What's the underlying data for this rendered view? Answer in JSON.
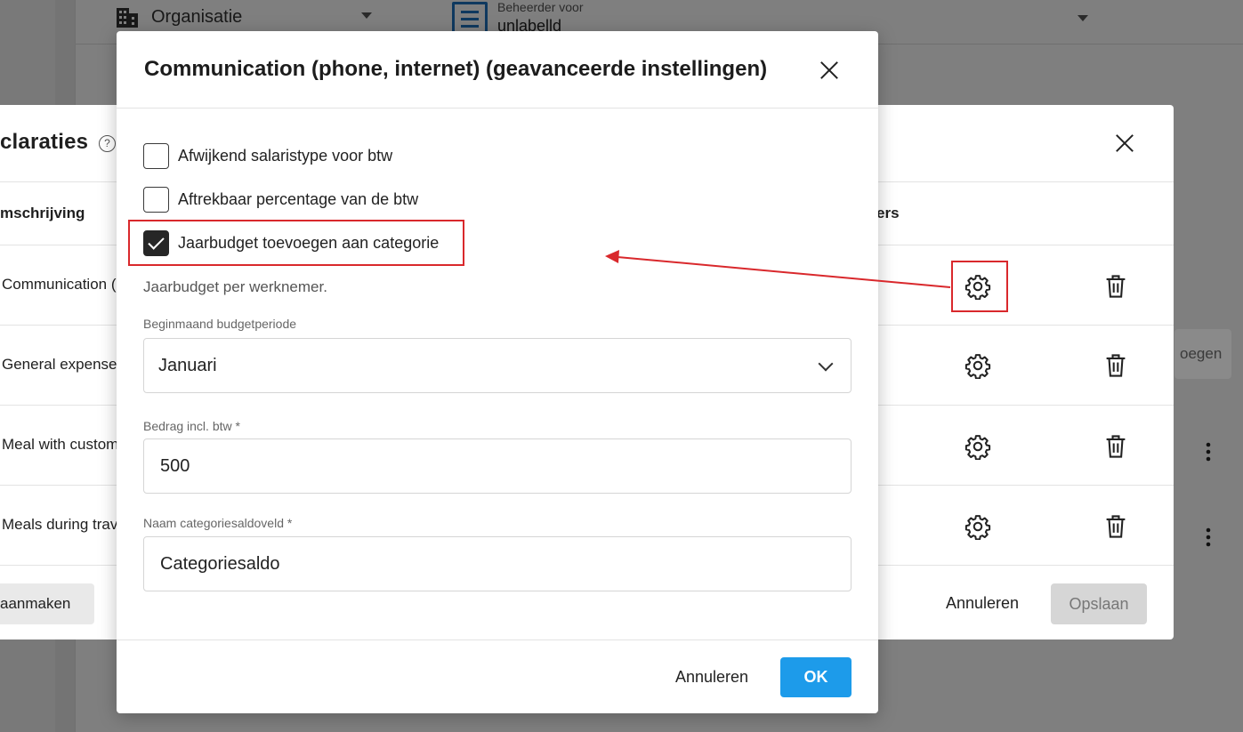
{
  "background": {
    "org_selector": {
      "label": "Organisatie",
      "icon": "building-icon"
    },
    "admin_selector": {
      "small_label": "Beheerder voor",
      "value": "unlabelld",
      "icon": "document-list-icon"
    }
  },
  "declarations_dialog": {
    "title": "claraties",
    "help_icon": "help-circle-icon",
    "col_description": "mschrijving",
    "col_settings": "ers",
    "rows": [
      {
        "description": "Communication ("
      },
      {
        "description": "General expense"
      },
      {
        "description": "Meal with custom"
      },
      {
        "description": "Meals during trav"
      }
    ],
    "side_button": "oegen",
    "create_button": "aanmaken",
    "cancel_button": "Annuleren",
    "save_button": "Opslaan"
  },
  "advanced_dialog": {
    "title": "Communication (phone, internet) (geavanceerde instellingen)",
    "checkboxes": [
      {
        "label": "Afwijkend salaristype voor btw",
        "checked": false
      },
      {
        "label": "Aftrekbaar percentage van de btw",
        "checked": false
      },
      {
        "label": "Jaarbudget toevoegen aan categorie",
        "checked": true
      }
    ],
    "hint": "Jaarbudget per werknemer.",
    "start_month": {
      "label": "Beginmaand budgetperiode",
      "value": "Januari"
    },
    "amount": {
      "label": "Bedrag incl. btw *",
      "value": "500"
    },
    "balance_field_name": {
      "label": "Naam categoriesaldoveld *",
      "value": "Categoriesaldo"
    },
    "cancel_button": "Annuleren",
    "ok_button": "OK"
  },
  "colors": {
    "accent": "#1d9bea",
    "annotation": "#d9282c",
    "checkbox_checked": "#262626"
  }
}
